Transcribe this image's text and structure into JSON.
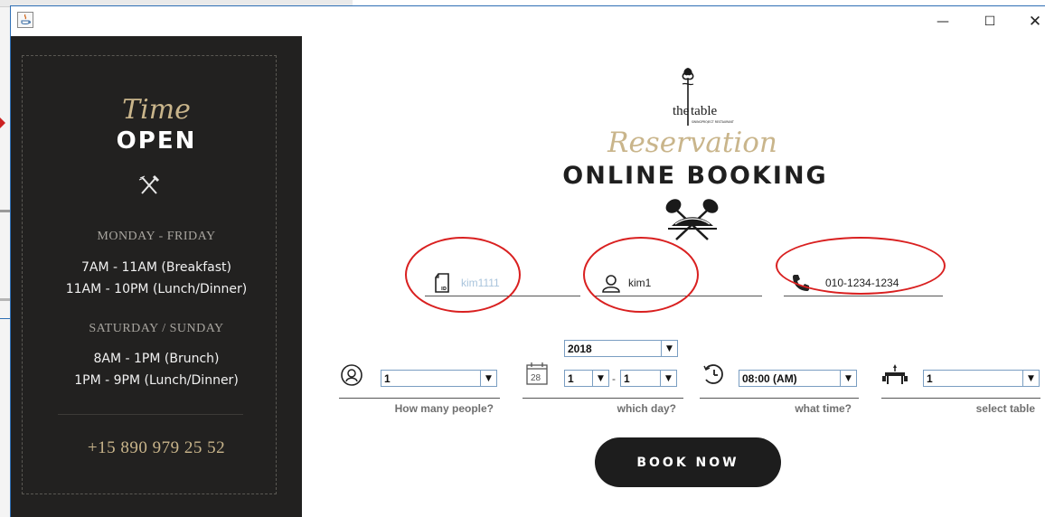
{
  "window": {
    "minimize_glyph": "—",
    "maximize_glyph": "☐",
    "close_glyph": "✕"
  },
  "sidebar": {
    "time_script": "Time",
    "open_title": "OPEN",
    "weekday_heading": "MONDAY - FRIDAY",
    "weekday_hours": [
      "7AM - 11AM (Breakfast)",
      "11AM - 10PM (Lunch/Dinner)"
    ],
    "weekend_heading": "SATURDAY / SUNDAY",
    "weekend_hours": [
      "8AM - 1PM (Brunch)",
      "1PM - 9PM (Lunch/Dinner)"
    ],
    "phone": "+15 890 979 25 52"
  },
  "brand": {
    "logo_the": "the",
    "logo_table": "table",
    "logo_tagline": "SWINGPROJECT RESTAURANT",
    "reservation_script": "Reservation",
    "booking_title": "ONLINE BOOKING"
  },
  "form": {
    "user_id": "kim1111",
    "user_name": "kim1",
    "phone": "010-1234-1234",
    "people": {
      "value": "1",
      "label": "How many people?"
    },
    "day": {
      "year": "2018",
      "month": "1",
      "separator": "-",
      "day": "1",
      "calendar_num": "28",
      "label": "which day?"
    },
    "time": {
      "value": "08:00 (AM)",
      "label": "what time?"
    },
    "table": {
      "value": "1",
      "label": "select table"
    },
    "dropdown_glyph": "▼",
    "book_button": "BOOK NOW"
  },
  "colors": {
    "sidebar_bg": "#222120",
    "gold_accent": "#c9b58b",
    "button_bg": "#1d1d1d",
    "annotation_red": "#d92020",
    "combo_border": "#7a9ec2"
  },
  "icons": {
    "app": "java-icon",
    "cutlery": "fork-knife-icon",
    "id_field": "id-card-icon",
    "name_field": "user-icon",
    "phone_field": "phone-icon",
    "people": "person-circle-icon",
    "day": "calendar-icon",
    "time": "clock-icon",
    "table": "dining-table-icon"
  }
}
